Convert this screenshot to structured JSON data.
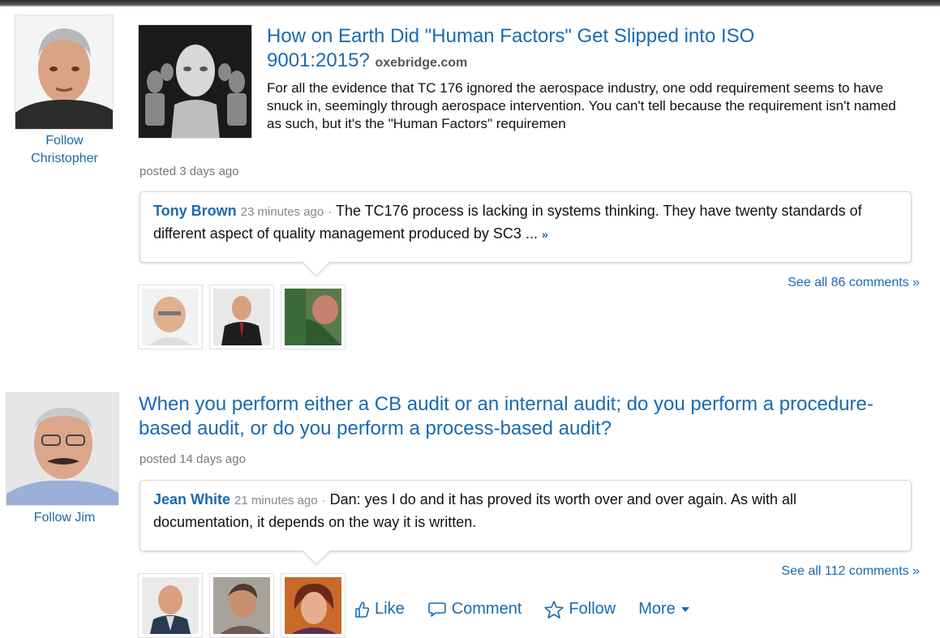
{
  "posts": [
    {
      "author_follow": "Follow Christopher",
      "title": "How on Earth Did \"Human Factors\" Get Slipped into ISO 9001:2015?",
      "source": "oxebridge.com",
      "summary": "For all the evidence that TC 176 ignored the aerospace industry, one odd requirement seems to have snuck in, seemingly through aerospace intervention. You can't tell because the requirement isn't named as such, but it's the \"Human Factors\" requiremen",
      "posted": "posted 3 days ago",
      "comment": {
        "author": "Tony Brown",
        "time": "23 minutes ago",
        "separator": "·",
        "text": "The TC176 process is lacking in systems thinking. They have twenty standards of different aspect of quality management produced by SC3 ...",
        "more": "»"
      },
      "see_all": "See all 86 comments »"
    },
    {
      "author_follow": "Follow Jim",
      "title": "When you perform either a CB audit or an internal audit; do you perform a procedure-based audit, or do you perform a process-based audit?",
      "posted": "posted 14 days ago",
      "comment": {
        "author": "Jean White",
        "time": "21 minutes ago",
        "separator": "·",
        "text": "Dan: yes I do and it has proved its worth over and over again. As with all documentation, it depends on the way it is written."
      },
      "see_all": "See all 112 comments »"
    }
  ],
  "actions": {
    "like": "Like",
    "comment": "Comment",
    "follow": "Follow",
    "more": "More"
  },
  "colors": {
    "link": "#1a6ab0",
    "muted": "#777777"
  }
}
